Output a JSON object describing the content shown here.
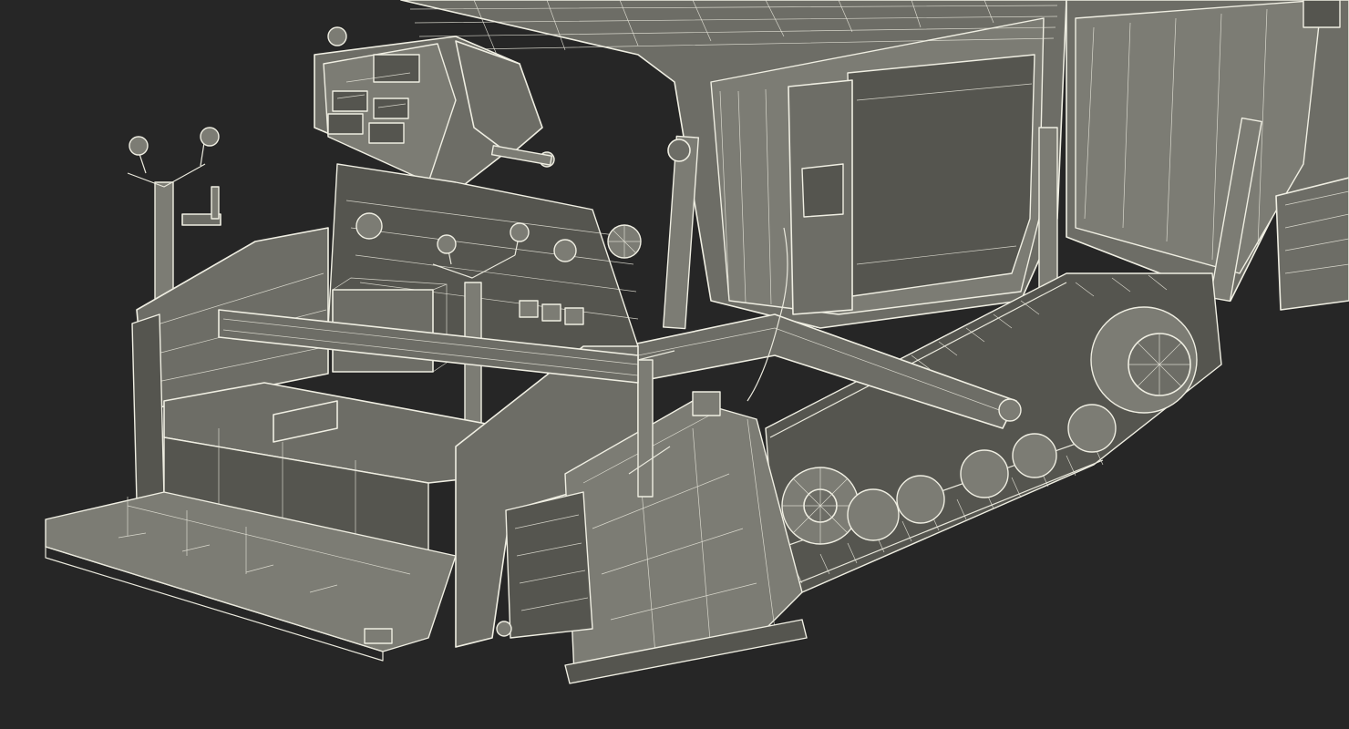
{
  "scene": {
    "background": "#262626",
    "palette": {
      "surface": "#6d6d66",
      "surface_dark": "#55554f",
      "surface_light": "#7c7c74",
      "wire": "#efeee2"
    }
  }
}
